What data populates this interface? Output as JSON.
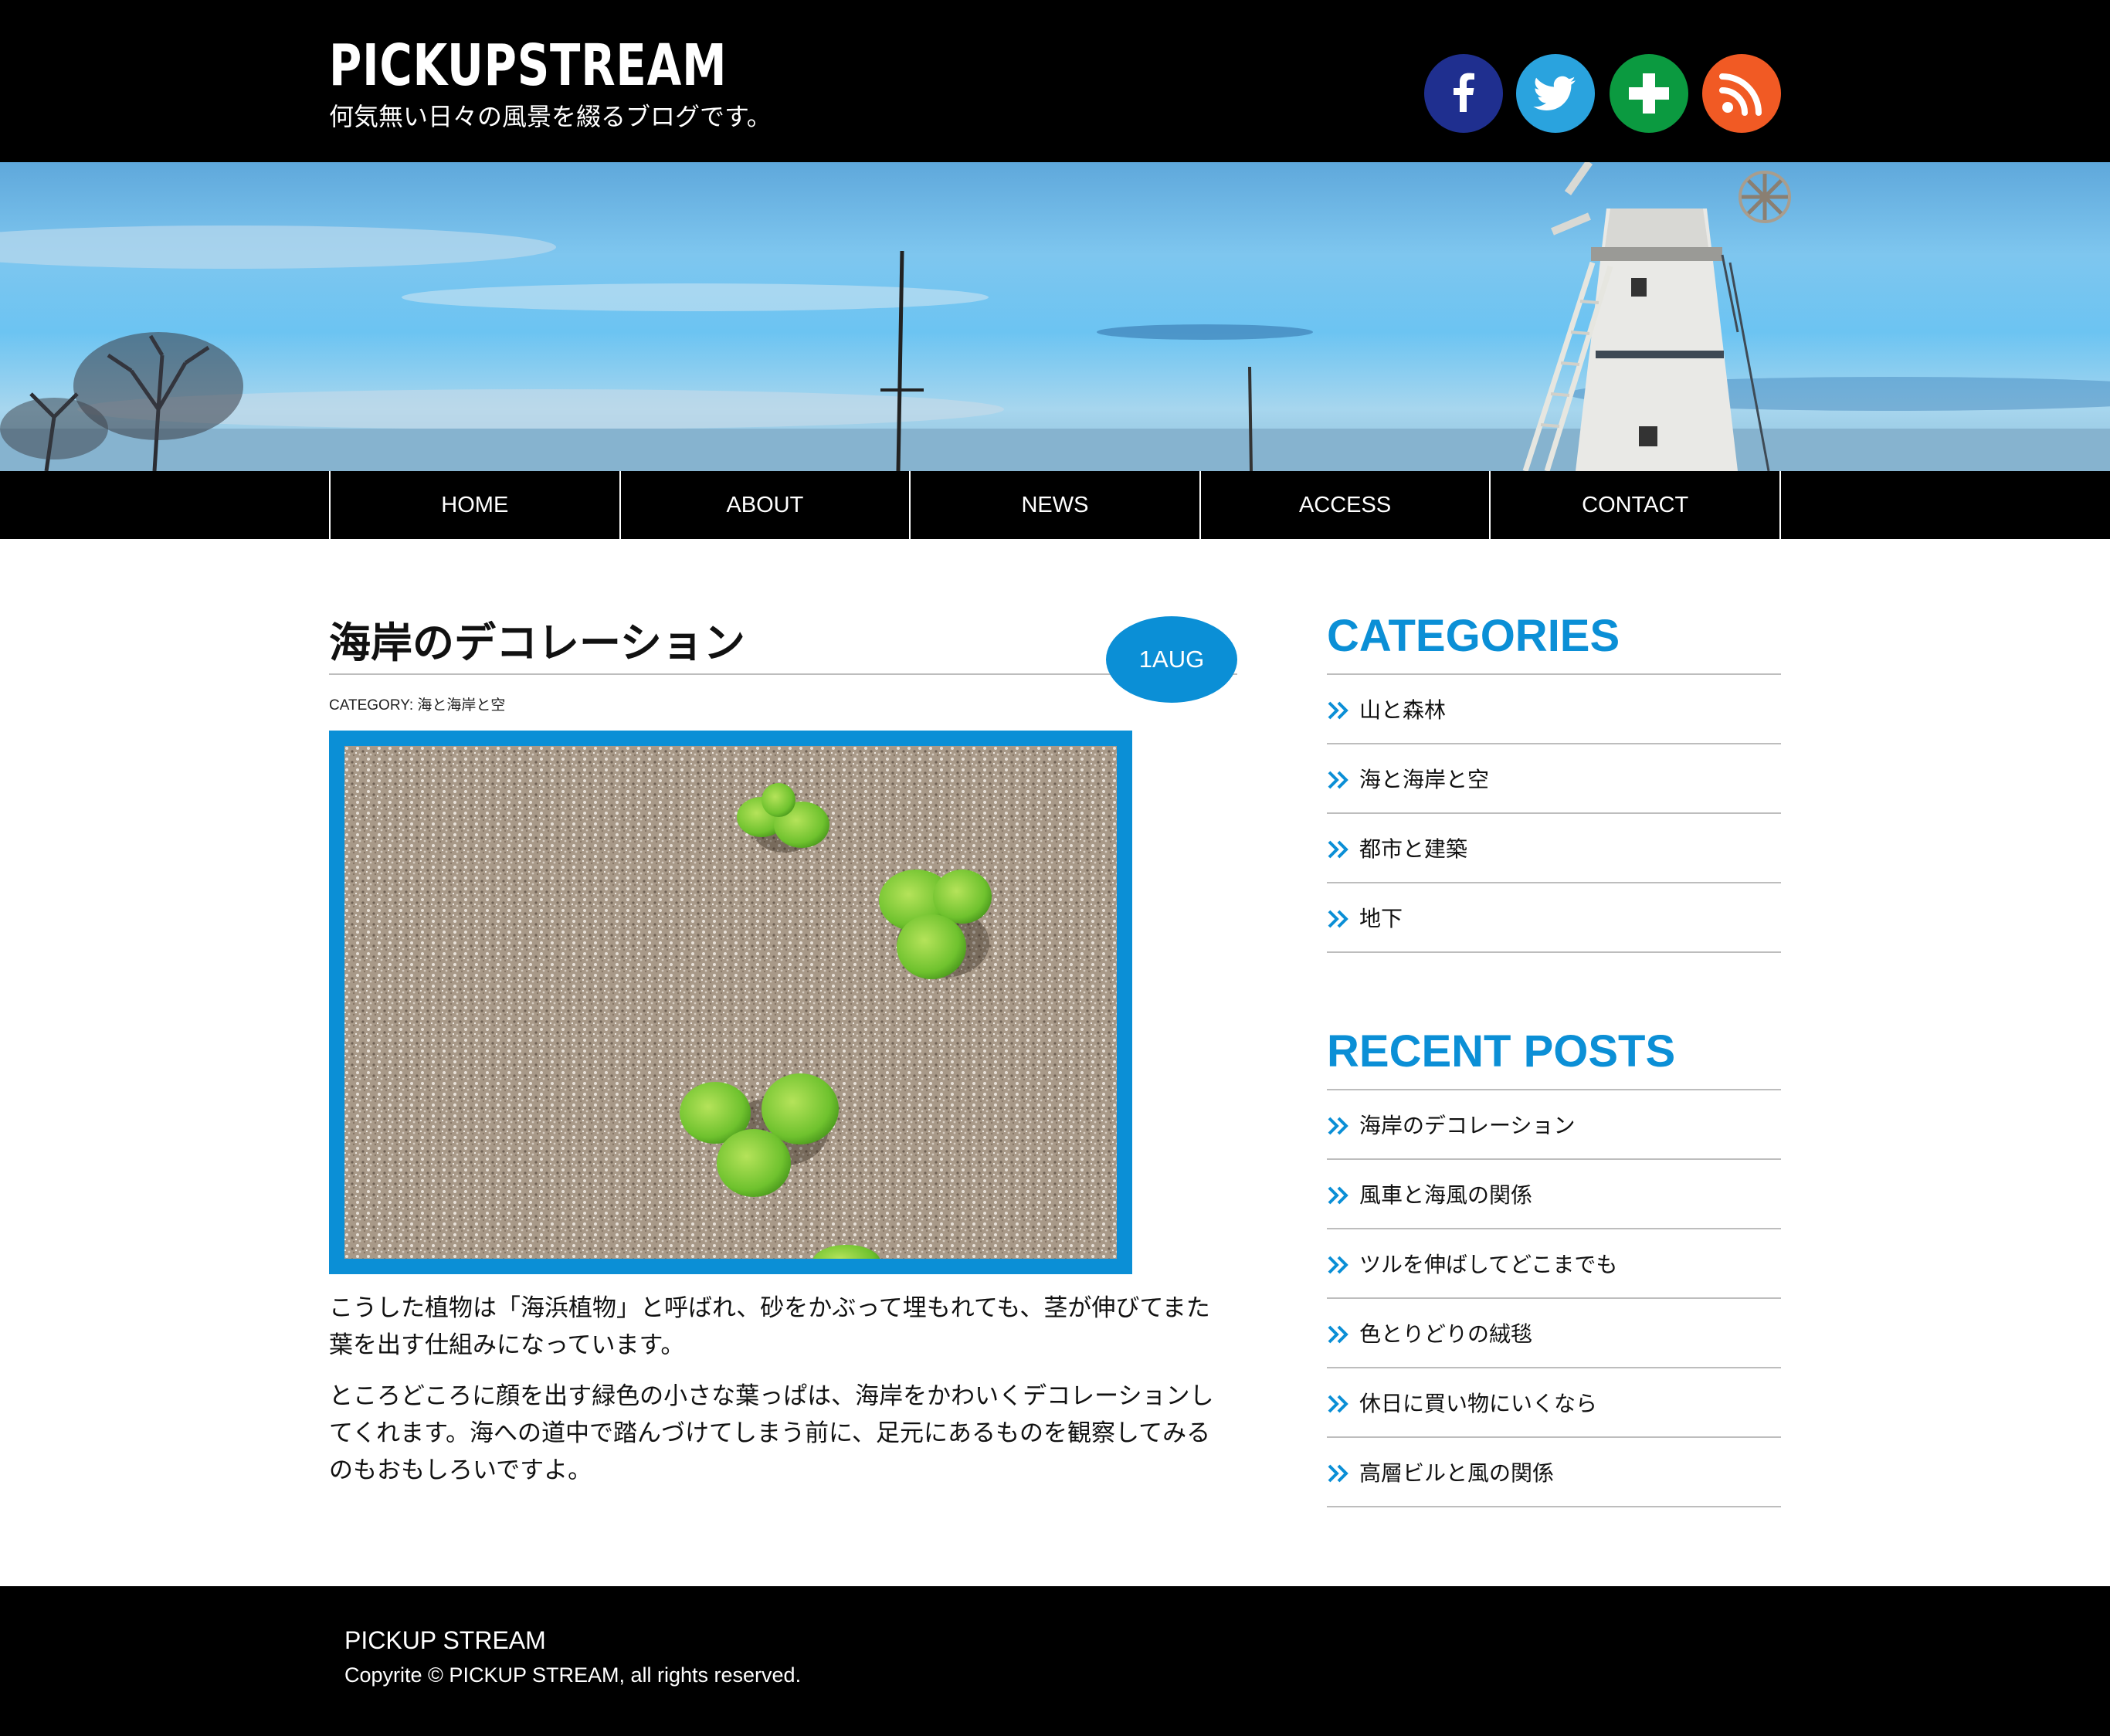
{
  "site": {
    "logo": "PICKUPSTREAM",
    "tagline": "何気無い日々の風景を綴るブログです。"
  },
  "social": [
    {
      "name": "facebook",
      "icon": "facebook-icon",
      "color": "#1f2f8f"
    },
    {
      "name": "twitter",
      "icon": "twitter-icon",
      "color": "#2aa3de"
    },
    {
      "name": "plus",
      "icon": "plus-icon",
      "color": "#0b9a40"
    },
    {
      "name": "rss",
      "icon": "rss-icon",
      "color": "#f15a24"
    }
  ],
  "nav": {
    "items": [
      "HOME",
      "ABOUT",
      "NEWS",
      "ACCESS",
      "CONTACT"
    ]
  },
  "post": {
    "title": "海岸のデコレーション",
    "date": "1AUG",
    "category": "CATEGORY: 海と海岸と空",
    "paragraphs": [
      "こうした植物は「海浜植物」と呼ばれ、砂をかぶって埋もれても、茎が伸びてまた葉を出す仕組みになっています。",
      "ところどころに顔を出す緑色の小さな葉っぱは、海岸をかわいくデコレーションしてくれます。海への道中で踏んづけてしまう前に、足元にあるものを観察してみるのもおもしろいですよ。"
    ]
  },
  "sidebar": {
    "categories": {
      "heading": "CATEGORIES",
      "items": [
        "山と森林",
        "海と海岸と空",
        "都市と建築",
        "地下"
      ]
    },
    "recent": {
      "heading": "RECENT POSTS",
      "items": [
        "海岸のデコレーション",
        "風車と海風の関係",
        "ツルを伸ばしてどこまでも",
        "色とりどりの絨毯",
        "休日に買い物にいくなら",
        "高層ビルと風の関係"
      ]
    }
  },
  "footer": {
    "title": "PICKUP STREAM",
    "copyright": "Copyrite © PICKUP STREAM, all rights reserved."
  },
  "colors": {
    "accent": "#0b8fd6",
    "header_bg": "#000000"
  }
}
